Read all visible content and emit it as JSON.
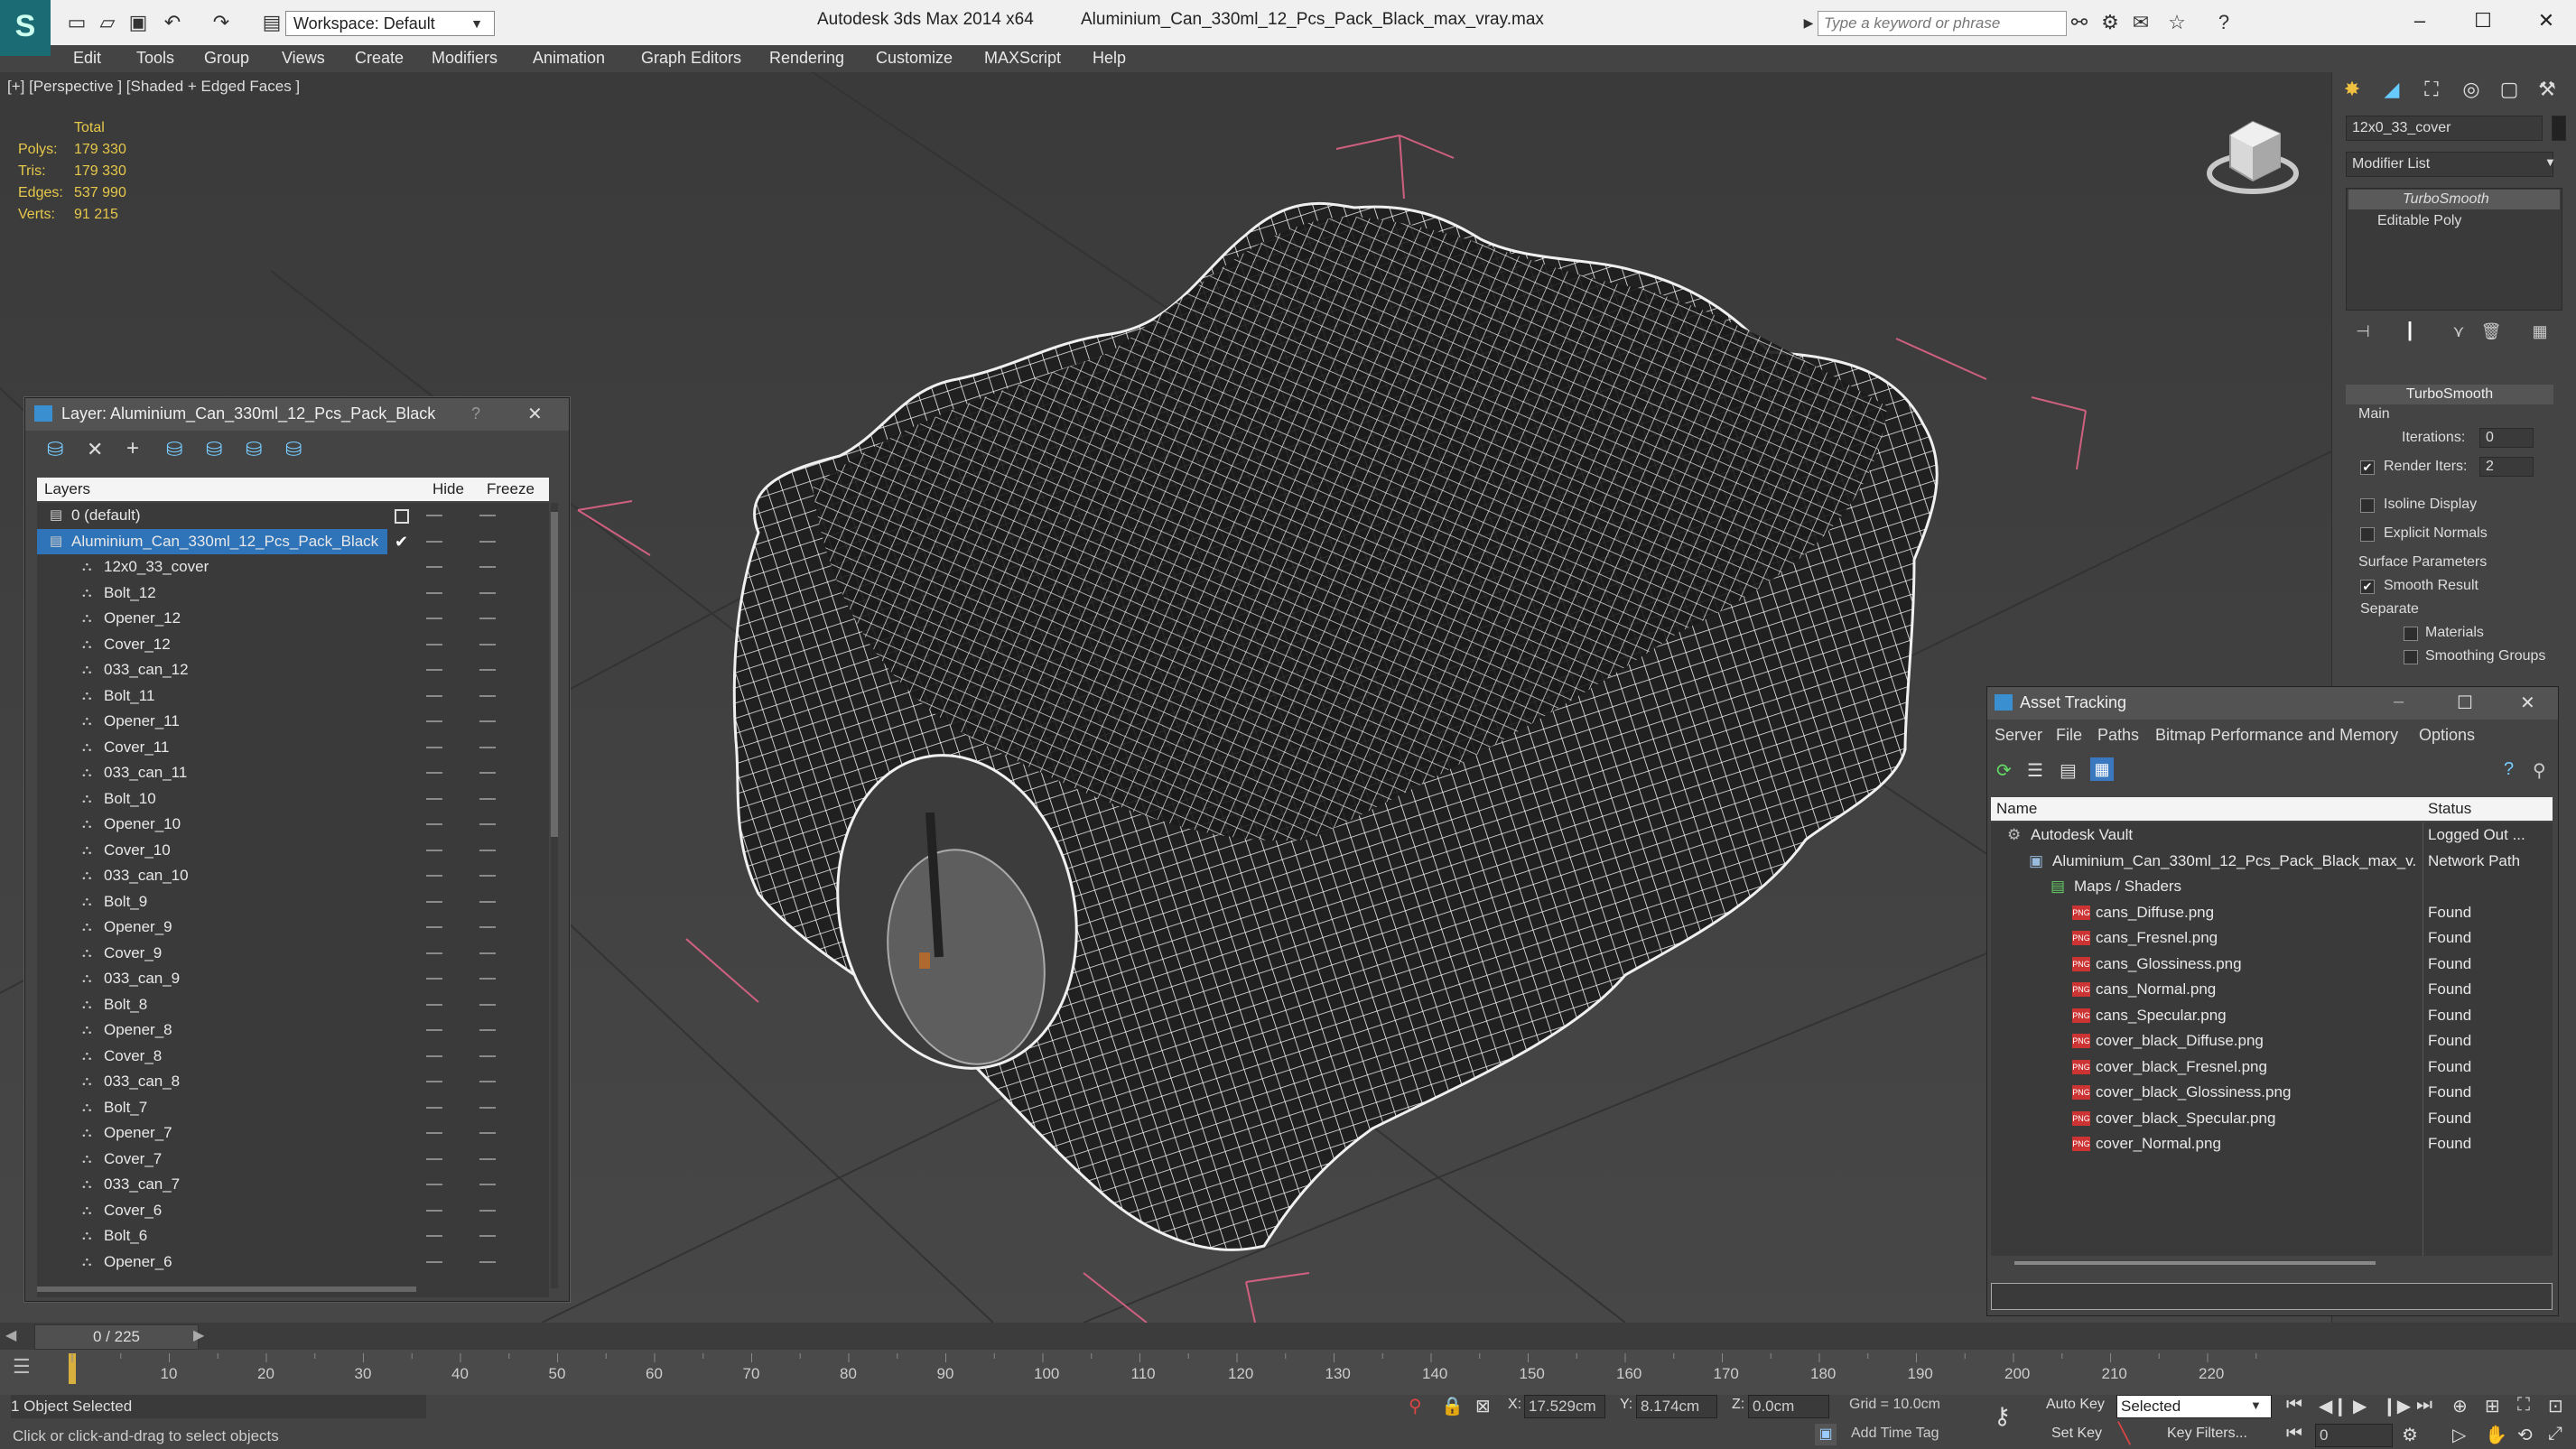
{
  "titlebar": {
    "app": "Autodesk 3ds Max  2014 x64",
    "file": "Aluminium_Can_330ml_12_Pcs_Pack_Black_max_vray.max",
    "workspace": "Workspace: Default",
    "search_placeholder": "Type a keyword or phrase"
  },
  "menu": [
    "Edit",
    "Tools",
    "Group",
    "Views",
    "Create",
    "Modifiers",
    "Animation",
    "Graph Editors",
    "Rendering",
    "Customize",
    "MAXScript",
    "Help"
  ],
  "viewport": {
    "label": "[+] [Perspective ] [Shaded + Edged Faces ]",
    "stats": {
      "header": "Total",
      "rows": [
        {
          "label": "Polys:",
          "value": "179 330"
        },
        {
          "label": "Tris:",
          "value": "179 330"
        },
        {
          "label": "Edges:",
          "value": "537 990"
        },
        {
          "label": "Verts:",
          "value": "91 215"
        }
      ]
    }
  },
  "cmdpanel": {
    "object_name": "12x0_33_cover",
    "modifier_list": "Modifier List",
    "stack": [
      "TurboSmooth",
      "Editable Poly"
    ],
    "rollout_title": "TurboSmooth",
    "main_label": "Main",
    "iterations_label": "Iterations:",
    "iterations_value": "0",
    "render_iters_label": "Render Iters:",
    "render_iters_value": "2",
    "isoline": "Isoline Display",
    "explicit": "Explicit Normals",
    "surface_params": "Surface Parameters",
    "smooth_result": "Smooth Result",
    "separate": "Separate",
    "materials": "Materials",
    "smoothing_groups": "Smoothing Groups"
  },
  "layer_window": {
    "title": "Layer: Aluminium_Can_330ml_12_Pcs_Pack_Black",
    "help": "?",
    "col_layers": "Layers",
    "col_hide": "Hide",
    "col_freeze": "Freeze",
    "rows": [
      {
        "name": "0 (default)",
        "level": 1,
        "type": "layer"
      },
      {
        "name": "Aluminium_Can_330ml_12_Pcs_Pack_Black",
        "level": 1,
        "type": "layer",
        "selected": true
      },
      {
        "name": "12x0_33_cover",
        "level": 2,
        "type": "obj"
      },
      {
        "name": "Bolt_12",
        "level": 2,
        "type": "obj"
      },
      {
        "name": "Opener_12",
        "level": 2,
        "type": "obj"
      },
      {
        "name": "Cover_12",
        "level": 2,
        "type": "obj"
      },
      {
        "name": "033_can_12",
        "level": 2,
        "type": "obj"
      },
      {
        "name": "Bolt_11",
        "level": 2,
        "type": "obj"
      },
      {
        "name": "Opener_11",
        "level": 2,
        "type": "obj"
      },
      {
        "name": "Cover_11",
        "level": 2,
        "type": "obj"
      },
      {
        "name": "033_can_11",
        "level": 2,
        "type": "obj"
      },
      {
        "name": "Bolt_10",
        "level": 2,
        "type": "obj"
      },
      {
        "name": "Opener_10",
        "level": 2,
        "type": "obj"
      },
      {
        "name": "Cover_10",
        "level": 2,
        "type": "obj"
      },
      {
        "name": "033_can_10",
        "level": 2,
        "type": "obj"
      },
      {
        "name": "Bolt_9",
        "level": 2,
        "type": "obj"
      },
      {
        "name": "Opener_9",
        "level": 2,
        "type": "obj"
      },
      {
        "name": "Cover_9",
        "level": 2,
        "type": "obj"
      },
      {
        "name": "033_can_9",
        "level": 2,
        "type": "obj"
      },
      {
        "name": "Bolt_8",
        "level": 2,
        "type": "obj"
      },
      {
        "name": "Opener_8",
        "level": 2,
        "type": "obj"
      },
      {
        "name": "Cover_8",
        "level": 2,
        "type": "obj"
      },
      {
        "name": "033_can_8",
        "level": 2,
        "type": "obj"
      },
      {
        "name": "Bolt_7",
        "level": 2,
        "type": "obj"
      },
      {
        "name": "Opener_7",
        "level": 2,
        "type": "obj"
      },
      {
        "name": "Cover_7",
        "level": 2,
        "type": "obj"
      },
      {
        "name": "033_can_7",
        "level": 2,
        "type": "obj"
      },
      {
        "name": "Cover_6",
        "level": 2,
        "type": "obj"
      },
      {
        "name": "Bolt_6",
        "level": 2,
        "type": "obj"
      },
      {
        "name": "Opener_6",
        "level": 2,
        "type": "obj"
      }
    ]
  },
  "asset_window": {
    "title": "Asset Tracking",
    "menu": [
      "Server",
      "File",
      "Paths",
      "Bitmap Performance and Memory",
      "Options"
    ],
    "col_name": "Name",
    "col_status": "Status",
    "rows": [
      {
        "name": "Autodesk Vault",
        "status": "Logged Out ...",
        "level": 1,
        "icon": "vault"
      },
      {
        "name": "Aluminium_Can_330ml_12_Pcs_Pack_Black_max_v...",
        "status": "Network Path",
        "level": 2,
        "icon": "max"
      },
      {
        "name": "Maps / Shaders",
        "status": "",
        "level": 3,
        "icon": "folder"
      },
      {
        "name": "cans_Diffuse.png",
        "status": "Found",
        "level": 4,
        "icon": "png"
      },
      {
        "name": "cans_Fresnel.png",
        "status": "Found",
        "level": 4,
        "icon": "png"
      },
      {
        "name": "cans_Glossiness.png",
        "status": "Found",
        "level": 4,
        "icon": "png"
      },
      {
        "name": "cans_Normal.png",
        "status": "Found",
        "level": 4,
        "icon": "png"
      },
      {
        "name": "cans_Specular.png",
        "status": "Found",
        "level": 4,
        "icon": "png"
      },
      {
        "name": "cover_black_Diffuse.png",
        "status": "Found",
        "level": 4,
        "icon": "png"
      },
      {
        "name": "cover_black_Fresnel.png",
        "status": "Found",
        "level": 4,
        "icon": "png"
      },
      {
        "name": "cover_black_Glossiness.png",
        "status": "Found",
        "level": 4,
        "icon": "png"
      },
      {
        "name": "cover_black_Specular.png",
        "status": "Found",
        "level": 4,
        "icon": "png"
      },
      {
        "name": "cover_Normal.png",
        "status": "Found",
        "level": 4,
        "icon": "png"
      }
    ]
  },
  "timeline": {
    "frame": "0 / 225",
    "ticks": [
      "10",
      "20",
      "30",
      "40",
      "50",
      "60",
      "70",
      "80",
      "90",
      "100",
      "110",
      "120",
      "130",
      "140",
      "150",
      "160",
      "170",
      "180",
      "190",
      "200",
      "210",
      "220"
    ]
  },
  "status": {
    "selected": "1 Object Selected",
    "prompt": "Click or click-and-drag to select objects",
    "x_label": "X:",
    "x_value": "17.529cm",
    "y_label": "Y:",
    "y_value": "8.174cm",
    "z_label": "Z:",
    "z_value": "0.0cm",
    "grid": "Grid = 10.0cm",
    "add_time_tag": "Add Time Tag",
    "auto_key": "Auto Key",
    "set_key": "Set Key",
    "selected_dropdown": "Selected",
    "key_filters": "Key Filters...",
    "frame_field": "0"
  }
}
